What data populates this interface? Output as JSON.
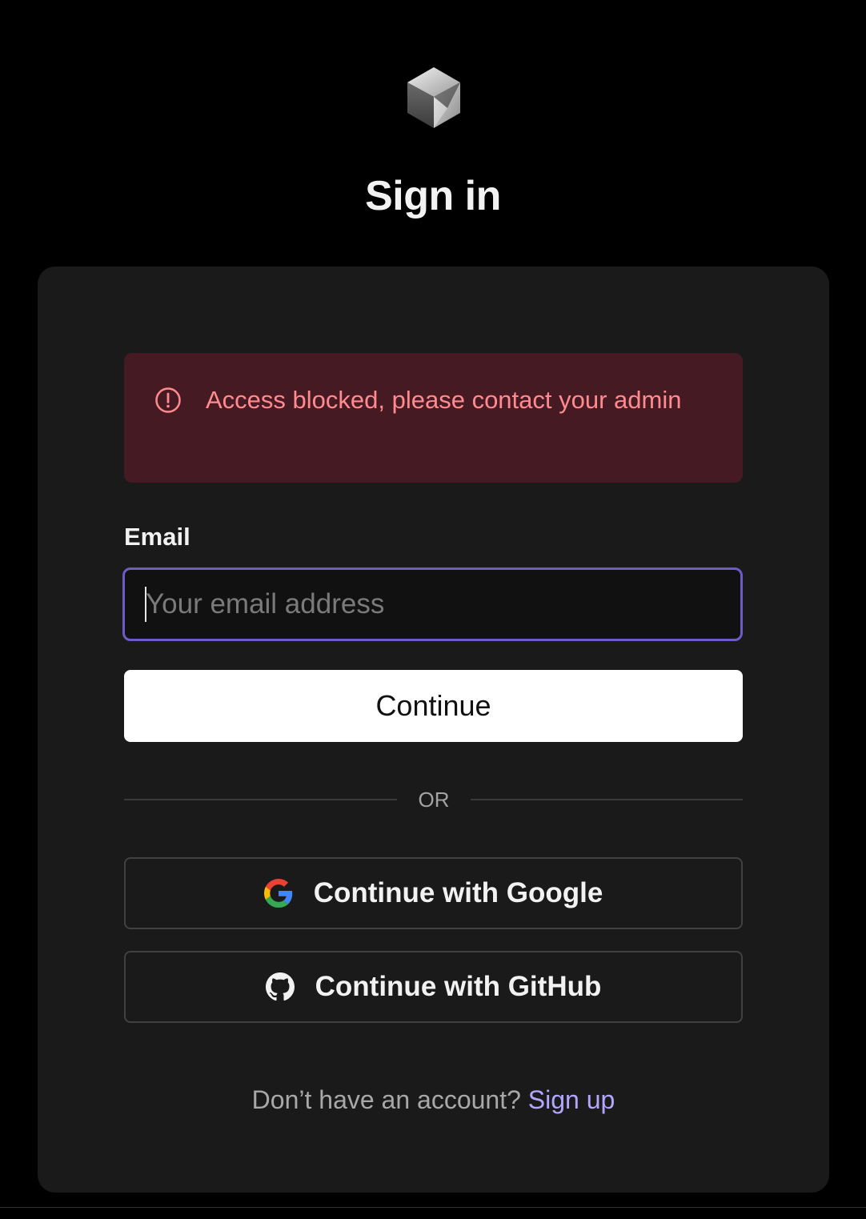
{
  "header": {
    "logo_icon": "cube-logo-icon",
    "title": "Sign in"
  },
  "alert": {
    "icon": "alert-circle-icon",
    "message": "Access blocked, please contact your admin",
    "background_color": "#461a23",
    "text_color": "#ff8a8f"
  },
  "form": {
    "email_label": "Email",
    "email_placeholder": "Your email address",
    "email_value": "",
    "focus_border_color": "#6e5cc6",
    "continue_label": "Continue"
  },
  "divider": {
    "label": "OR"
  },
  "oauth": {
    "google_label": "Continue with Google",
    "google_icon": "google-icon",
    "github_label": "Continue with GitHub",
    "github_icon": "github-icon"
  },
  "footer": {
    "prompt": "Don’t have an account?",
    "signup_link": "Sign up",
    "link_color": "#b3a6ff"
  }
}
